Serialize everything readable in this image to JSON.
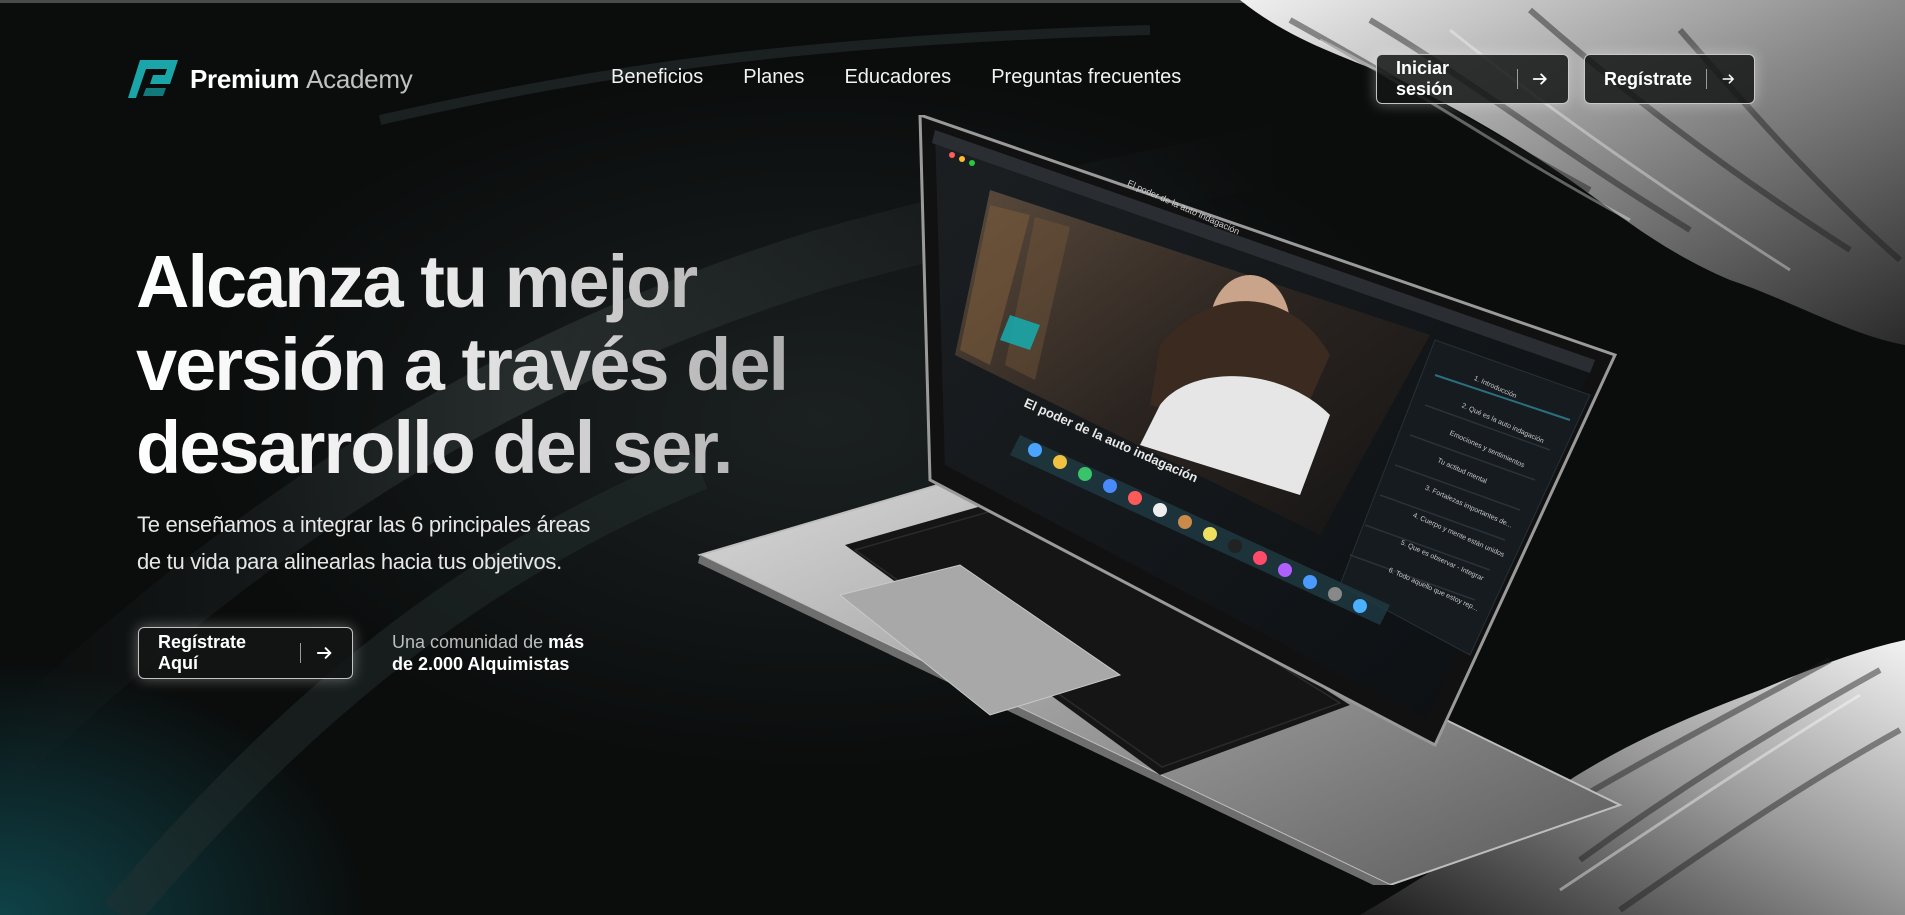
{
  "brand": {
    "name_primary": "Premium",
    "name_secondary": "Academy",
    "accent": "#1aa6a8"
  },
  "nav": {
    "items": [
      "Beneficios",
      "Planes",
      "Educadores",
      "Preguntas frecuentes"
    ]
  },
  "header_buttons": {
    "login": "Iniciar sesión",
    "register": "Regístrate"
  },
  "hero": {
    "title_lines": [
      "Alcanza tu mejor",
      "versión a través del",
      "desarrollo del ser."
    ],
    "subtitle_lines": [
      "Te enseñamos a integrar las 6 principales áreas",
      "de tu vida para alinearlas hacia tus objetivos."
    ],
    "cta": "Regístrate Aquí",
    "community_prefix": "Una comunidad de",
    "community_strong_1": "más",
    "community_strong_2": "de 2.000 Alquimistas"
  },
  "laptop_screen": {
    "course_title": "El poder de la auto indagación",
    "sidebar_items": [
      "1. Introducción",
      "2. Qué es la auto indagación",
      "Emociones y sentimientos",
      "Tu actitud mental",
      "3. Fortalezas importantes de...",
      "4. Cuerpo y mente están unidos",
      "5. Que es observar - Integrar",
      "6. Todo aquello que estoy rep..."
    ]
  },
  "icons": [
    "logo-mark-icon",
    "arrow-right-icon"
  ]
}
